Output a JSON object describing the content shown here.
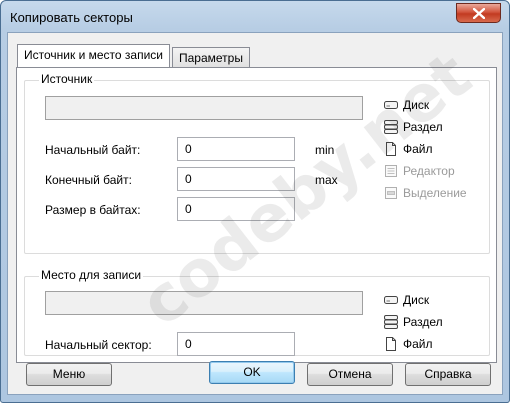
{
  "window": {
    "title": "Копировать секторы"
  },
  "tabs": [
    {
      "label": "Источник и место записи",
      "active": true
    },
    {
      "label": "Параметры",
      "active": false
    }
  ],
  "source": {
    "title": "Источник",
    "path": "",
    "fields": {
      "start_byte": {
        "label": "Начальный байт:",
        "value": "0",
        "unit": "min"
      },
      "end_byte": {
        "label": "Конечный байт:",
        "value": "0",
        "unit": "max"
      },
      "size_bytes": {
        "label": "Размер в байтах:",
        "value": "0"
      }
    },
    "options": [
      {
        "label": "Диск",
        "icon": "disk-icon",
        "enabled": true
      },
      {
        "label": "Раздел",
        "icon": "partition-icon",
        "enabled": true
      },
      {
        "label": "Файл",
        "icon": "file-icon",
        "enabled": true
      },
      {
        "label": "Редактор",
        "icon": "editor-icon",
        "enabled": false
      },
      {
        "label": "Выделение",
        "icon": "selection-icon",
        "enabled": false
      }
    ]
  },
  "destination": {
    "title": "Место для записи",
    "path": "",
    "fields": {
      "start_sector": {
        "label": "Начальный сектор:",
        "value": "0"
      }
    },
    "options": [
      {
        "label": "Диск",
        "icon": "disk-icon",
        "enabled": true
      },
      {
        "label": "Раздел",
        "icon": "partition-icon",
        "enabled": true
      },
      {
        "label": "Файл",
        "icon": "file-icon",
        "enabled": true
      }
    ]
  },
  "buttons": {
    "menu": "Меню",
    "ok": "OK",
    "cancel": "Отмена",
    "help": "Справка"
  },
  "watermark": "codeby.net"
}
